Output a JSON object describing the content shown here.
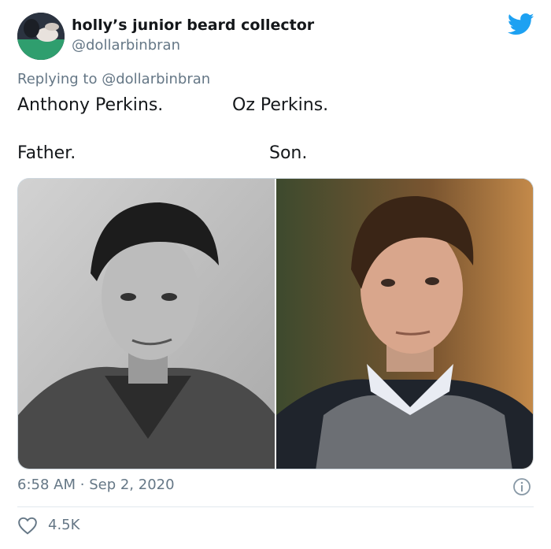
{
  "author": {
    "display_name": "holly’s junior beard collector",
    "handle": "@dollarbinbran",
    "avatar_icon": "user-avatar"
  },
  "brand": {
    "icon": "twitter-bird-icon",
    "color": "#1da1f2"
  },
  "reply_context": {
    "prefix": "Replying to",
    "mention": "@dollarbinbran"
  },
  "tweet": {
    "line1_left": "Anthony Perkins.",
    "line1_right": "Oz Perkins.",
    "line2_left": "Father.",
    "line2_right": "Son."
  },
  "media": {
    "left_photo": "black-and-white portrait of a man in a sweater",
    "right_photo": "color portrait of a man in a grey sweater vest"
  },
  "meta": {
    "time": "6:58 AM",
    "separator": "·",
    "date": "Sep 2, 2020",
    "info_icon": "info-icon"
  },
  "engagement": {
    "like_icon": "heart-icon",
    "likes": "4.5K"
  }
}
